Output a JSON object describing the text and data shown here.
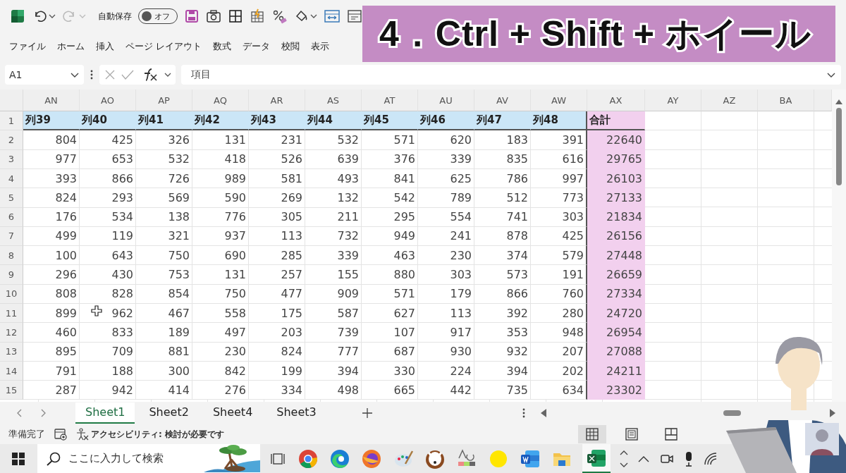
{
  "quick_access": {
    "autosave_label": "自動保存",
    "autosave": {
      "label": "オフ",
      "on": false
    }
  },
  "ribbon_tabs": [
    {
      "label": "ファイル"
    },
    {
      "label": "ホーム"
    },
    {
      "label": "挿入"
    },
    {
      "label": "ページ レイアウト"
    },
    {
      "label": "数式"
    },
    {
      "label": "データ"
    },
    {
      "label": "校閲"
    },
    {
      "label": "表示"
    }
  ],
  "formula_bar": {
    "name_box": "A1",
    "content": "項目"
  },
  "caption": "4．Ctrl + Shift +  ホイール",
  "sheet": {
    "columns": [
      "AN",
      "AO",
      "AP",
      "AQ",
      "AR",
      "AS",
      "AT",
      "AU",
      "AV",
      "AW",
      "AX",
      "AY",
      "AZ",
      "BA"
    ],
    "header_row": {
      "number": "1",
      "labels": [
        "列39",
        "列40",
        "列41",
        "列42",
        "列43",
        "列44",
        "列45",
        "列46",
        "列47",
        "列48"
      ],
      "total_label": "合計"
    },
    "rows": [
      {
        "number": "2",
        "values": [
          "804",
          "425",
          "326",
          "131",
          "231",
          "532",
          "571",
          "620",
          "183",
          "391"
        ],
        "total": "22640"
      },
      {
        "number": "3",
        "values": [
          "977",
          "653",
          "532",
          "418",
          "526",
          "639",
          "376",
          "339",
          "835",
          "616"
        ],
        "total": "29765"
      },
      {
        "number": "4",
        "values": [
          "393",
          "866",
          "726",
          "989",
          "581",
          "493",
          "841",
          "625",
          "786",
          "997"
        ],
        "total": "26103"
      },
      {
        "number": "5",
        "values": [
          "824",
          "293",
          "569",
          "590",
          "269",
          "132",
          "542",
          "789",
          "512",
          "773"
        ],
        "total": "27133"
      },
      {
        "number": "6",
        "values": [
          "176",
          "534",
          "138",
          "776",
          "305",
          "211",
          "295",
          "554",
          "741",
          "303"
        ],
        "total": "21834"
      },
      {
        "number": "7",
        "values": [
          "499",
          "119",
          "321",
          "937",
          "113",
          "732",
          "949",
          "241",
          "878",
          "425"
        ],
        "total": "26156"
      },
      {
        "number": "8",
        "values": [
          "100",
          "643",
          "750",
          "690",
          "285",
          "339",
          "463",
          "230",
          "374",
          "579"
        ],
        "total": "27448"
      },
      {
        "number": "9",
        "values": [
          "296",
          "430",
          "753",
          "131",
          "257",
          "155",
          "880",
          "303",
          "573",
          "191"
        ],
        "total": "26659"
      },
      {
        "number": "10",
        "values": [
          "808",
          "828",
          "854",
          "750",
          "477",
          "909",
          "571",
          "179",
          "866",
          "760"
        ],
        "total": "27334"
      },
      {
        "number": "11",
        "values": [
          "899",
          "962",
          "467",
          "558",
          "175",
          "587",
          "627",
          "113",
          "392",
          "280"
        ],
        "total": "24720"
      },
      {
        "number": "12",
        "values": [
          "460",
          "833",
          "189",
          "497",
          "203",
          "739",
          "107",
          "917",
          "353",
          "948"
        ],
        "total": "26954"
      },
      {
        "number": "13",
        "values": [
          "895",
          "709",
          "881",
          "230",
          "824",
          "777",
          "687",
          "930",
          "932",
          "207"
        ],
        "total": "27088"
      },
      {
        "number": "14",
        "values": [
          "791",
          "188",
          "300",
          "842",
          "199",
          "394",
          "330",
          "224",
          "394",
          "202"
        ],
        "total": "24211"
      },
      {
        "number": "15",
        "values": [
          "287",
          "942",
          "414",
          "276",
          "334",
          "498",
          "665",
          "442",
          "735",
          "634"
        ],
        "total": "23302"
      }
    ]
  },
  "sheet_tabs": [
    {
      "label": "Sheet1",
      "selected": true
    },
    {
      "label": "Sheet2",
      "selected": false
    },
    {
      "label": "Sheet4",
      "selected": false
    },
    {
      "label": "Sheet3",
      "selected": false
    }
  ],
  "status_bar": {
    "ready": "準備完了",
    "accessibility": "アクセシビリティ: 検討が必要です",
    "views": [
      {
        "kind": "normal",
        "selected": true
      },
      {
        "kind": "page_layout",
        "selected": false
      },
      {
        "kind": "page_break",
        "selected": false
      }
    ]
  },
  "taskbar": {
    "search_placeholder": "ここに入力して検索"
  }
}
